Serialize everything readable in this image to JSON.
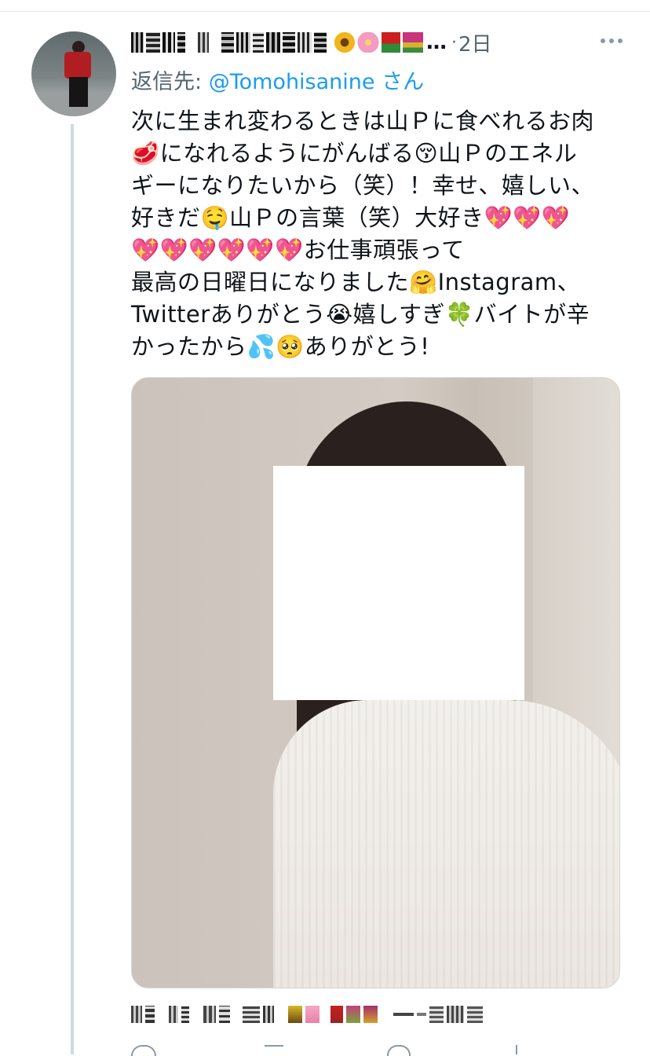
{
  "tweet": {
    "timestamp": "2日",
    "reply_prefix": "返信先:",
    "reply_handle": "@Tomohisanine",
    "reply_suffix": "さん",
    "text": "次に生まれ変わるときは山Ｐに食べれるお肉\n🥩になれるようにがんばる😚山Ｐのエネル\nギーになりたいから（笑）！幸せ、嬉しい、\n好きだ🤤山Ｐの言葉（笑）大好き💖💖💖\n💖💖💖💖💖💖お仕事頑張って\n最高の日曜日になりました🤗Instagram、\nTwitterありがとう😭嬉しすぎ🍀バイトが辛\nかったから💦🥺ありがとう!"
  },
  "icons": {
    "more": "more-horizontal-icon",
    "avatar": "user-avatar"
  },
  "colors": {
    "link": "#1d9bf0",
    "secondary_text": "#536471",
    "thread_line": "#cfd9de"
  }
}
